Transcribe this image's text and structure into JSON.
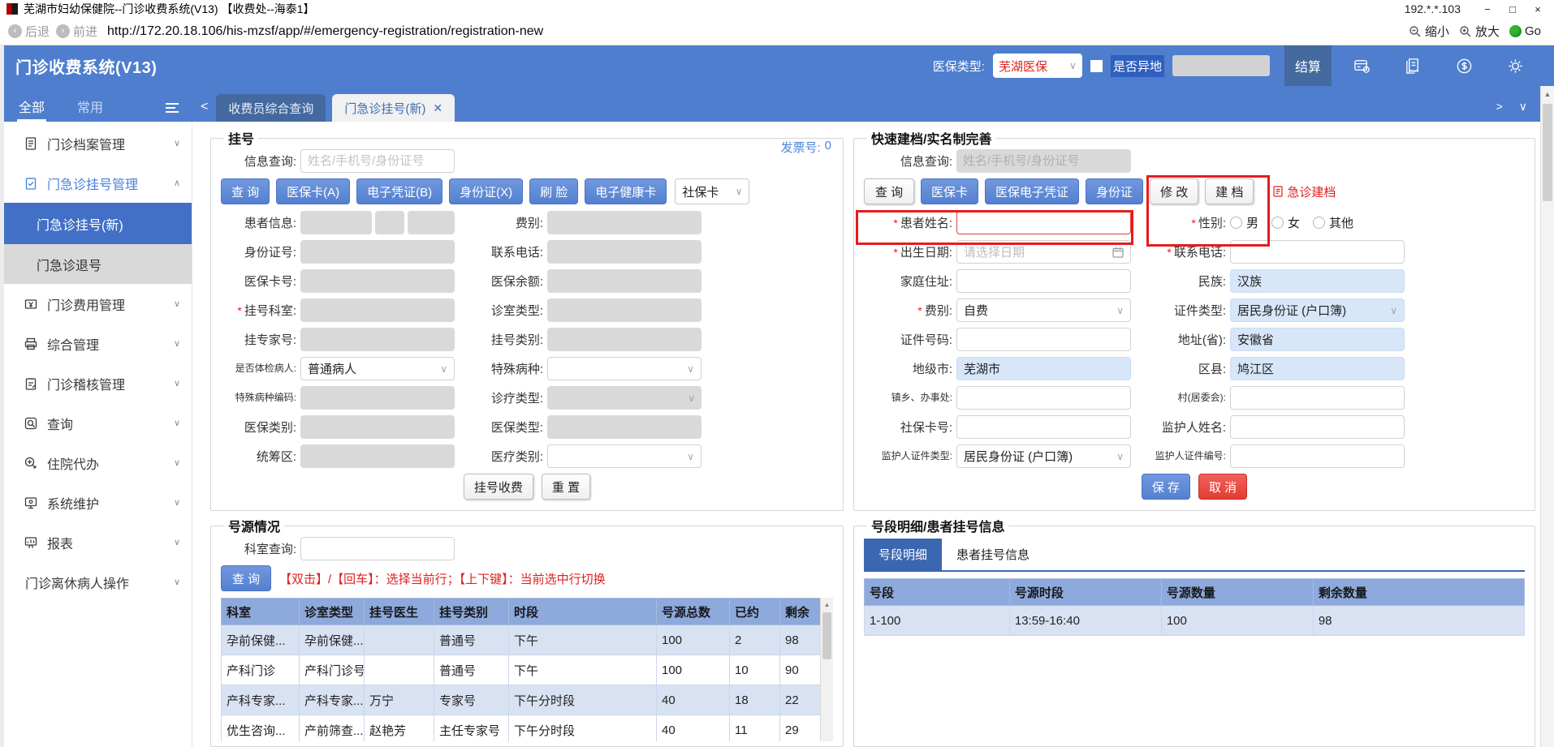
{
  "titlebar": {
    "title": "芜湖市妇幼保健院--门诊收费系统(V13) 【收费处--海泰1】",
    "ip": "192.*.*.103",
    "minimize": "−",
    "maximize": "□",
    "close": "×"
  },
  "browser": {
    "back": "后退",
    "forward": "前进",
    "url": "http://172.20.18.106/his-mzsf/app/#/emergency-registration/registration-new",
    "zoom_out": "缩小",
    "zoom_in": "放大",
    "go": "Go"
  },
  "appbar": {
    "title": "门诊收费系统(V13)",
    "insurance_type_label": "医保类型:",
    "insurance_type_value": "芜湖医保",
    "is_remote_label": "是否异地",
    "settle": "结算"
  },
  "sidebar": {
    "tab_all": "全部",
    "tab_common": "常用",
    "groups": [
      "门诊档案管理",
      "门急诊挂号管理",
      "门诊费用管理",
      "综合管理",
      "门诊稽核管理",
      "查询",
      "住院代办",
      "系统维护",
      "报表",
      "门诊离休病人操作"
    ],
    "children": [
      "门急诊挂号(新)",
      "门急诊退号"
    ]
  },
  "tabbar": {
    "tab1": "收费员综合查询",
    "tab2": "门急诊挂号(新)"
  },
  "registration": {
    "legend": "挂号",
    "invoice_label": "发票号:",
    "invoice_value": "0",
    "info_query_label": "信息查询:",
    "info_query_placeholder": "姓名/手机号/身份证号",
    "btn_query": "查 询",
    "btn_insurance_card": "医保卡(A)",
    "btn_e_voucher": "电子凭证(B)",
    "btn_id_card": "身份证(X)",
    "btn_face": "刷 脸",
    "btn_e_health_card": "电子健康卡",
    "social_card": "社保卡",
    "lbl_patient_info": "患者信息:",
    "lbl_fee_type": "费别:",
    "lbl_id_no": "身份证号:",
    "lbl_phone": "联系电话:",
    "lbl_card_no": "医保卡号:",
    "lbl_balance": "医保余额:",
    "lbl_dept": "挂号科室:",
    "lbl_clinic_type": "诊室类型:",
    "lbl_expert": "挂专家号:",
    "lbl_reg_class": "挂号类别:",
    "lbl_exam_patient": "是否体检病人:",
    "val_exam_patient": "普通病人",
    "lbl_special_disease": "特殊病种:",
    "lbl_special_code": "特殊病种编码:",
    "lbl_treat_type": "诊疗类型:",
    "lbl_ins_class": "医保类别:",
    "lbl_ins_type": "医保类型:",
    "lbl_pool_area": "统筹区:",
    "lbl_med_class": "医疗类别:",
    "btn_reg_charge": "挂号收费",
    "btn_reset": "重 置"
  },
  "quick_profile": {
    "legend": "快速建档/实名制完善",
    "info_query_label": "信息查询:",
    "info_query_placeholder": "姓名/手机号/身份证号",
    "btn_query": "查 询",
    "btn_insurance_card": "医保卡",
    "btn_ins_e_voucher": "医保电子凭证",
    "btn_id_card": "身份证",
    "btn_modify": "修 改",
    "btn_create": "建 档",
    "btn_emergency_create": "急诊建档",
    "lbl_name": "患者姓名:",
    "lbl_gender": "性别:",
    "gender_options": [
      "男",
      "女",
      "其他"
    ],
    "lbl_birth": "出生日期:",
    "birth_placeholder": "请选择日期",
    "lbl_phone": "联系电话:",
    "lbl_address": "家庭住址:",
    "lbl_nation": "民族:",
    "val_nation": "汉族",
    "lbl_fee": "费别:",
    "val_fee": "自费",
    "lbl_cert_type": "证件类型:",
    "val_cert_type": "居民身份证 (户口簿)",
    "lbl_cert_no": "证件号码:",
    "lbl_province": "地址(省):",
    "val_province": "安徽省",
    "lbl_city": "地级市:",
    "val_city": "芜湖市",
    "lbl_county": "区县:",
    "val_county": "鸠江区",
    "lbl_township": "镇乡、办事处:",
    "lbl_village": "村(居委会):",
    "lbl_social_card": "社保卡号:",
    "lbl_guardian_name": "监护人姓名:",
    "lbl_guardian_cert_type": "监护人证件类型:",
    "val_guardian_cert_type": "居民身份证 (户口簿)",
    "lbl_guardian_cert_no": "监护人证件编号:",
    "btn_save": "保 存",
    "btn_cancel": "取 消"
  },
  "slot_panel": {
    "legend": "号源情况",
    "dept_query_label": "科室查询:",
    "btn_query": "查 询",
    "hint": "【双击】/【回车】：选择当前行；【上下键】：当前选中行切换",
    "headers": [
      "科室",
      "诊室类型",
      "挂号医生",
      "挂号类别",
      "时段",
      "号源总数",
      "已约",
      "剩余"
    ],
    "rows": [
      [
        "孕前保健...",
        "孕前保健...",
        "",
        "普通号",
        "下午",
        "100",
        "2",
        "98"
      ],
      [
        "产科门诊",
        "产科门诊号",
        "",
        "普通号",
        "下午",
        "100",
        "10",
        "90"
      ],
      [
        "产科专家...",
        "产科专家...",
        "万宁",
        "专家号",
        "下午分时段",
        "40",
        "18",
        "22"
      ],
      [
        "优生咨询...",
        "产前筛查...",
        "赵艳芳",
        "主任专家号",
        "下午分时段",
        "40",
        "11",
        "29"
      ]
    ]
  },
  "segment_panel": {
    "legend": "号段明细/患者挂号信息",
    "tab_detail": "号段明细",
    "tab_patient": "患者挂号信息",
    "headers": [
      "号段",
      "号源时段",
      "号源数量",
      "剩余数量"
    ],
    "rows": [
      [
        "1-100",
        "13:59-16:40",
        "100",
        "98"
      ]
    ]
  }
}
